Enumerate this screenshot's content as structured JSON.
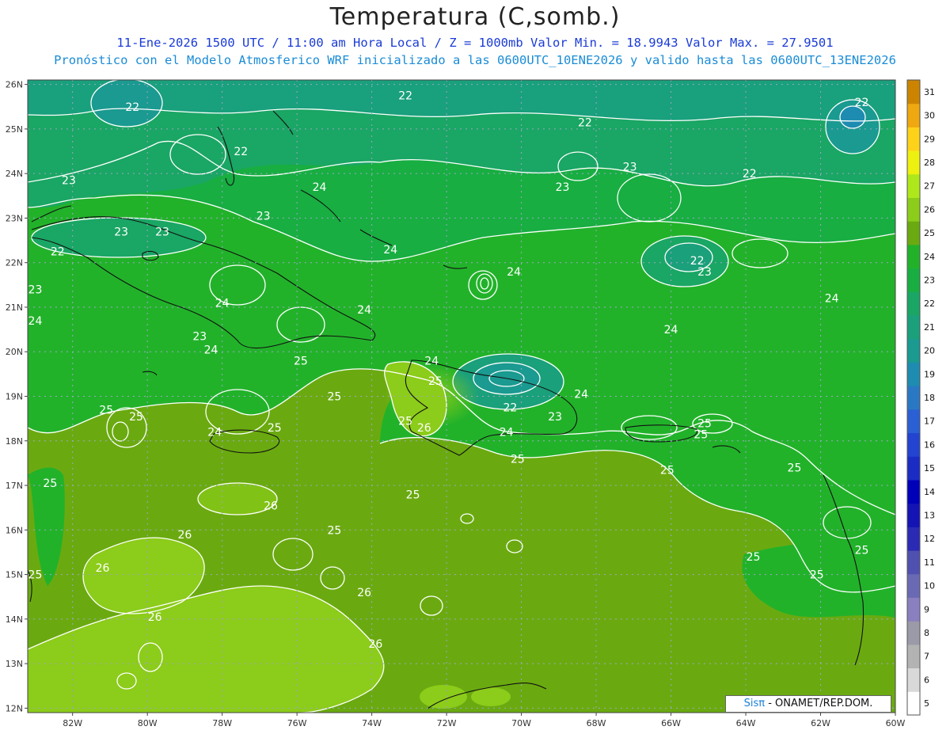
{
  "header": {
    "title": "Temperatura (C,somb.)",
    "line1": "11-Ene-2026 1500 UTC / 11:00 am Hora Local / Z = 1000mb  Valor Min. = 18.9943  Valor Max. = 27.9501",
    "line2": "Pronóstico con el Modelo Atmosferico WRF inicializado a las 0600UTC_10ENE2026 y valido hasta las  0600UTC_13ENE2026"
  },
  "map": {
    "lat_ticks": [
      "26N",
      "25N",
      "24N",
      "23N",
      "22N",
      "21N",
      "20N",
      "19N",
      "18N",
      "17N",
      "16N",
      "15N",
      "14N",
      "13N",
      "12N"
    ],
    "lon_ticks": [
      "82W",
      "80W",
      "78W",
      "76W",
      "74W",
      "72W",
      "70W",
      "68W",
      "66W",
      "64W",
      "62W",
      "60W"
    ],
    "grid": true
  },
  "colorbar": {
    "levels": [
      "5",
      "6",
      "7",
      "8",
      "9",
      "10",
      "11",
      "12",
      "13",
      "14",
      "15",
      "16",
      "17",
      "18",
      "19",
      "20",
      "21",
      "22",
      "23",
      "24",
      "25",
      "26",
      "27",
      "28",
      "29",
      "30",
      "31"
    ],
    "colors": [
      "#ffffff",
      "#d9d9d9",
      "#b3b3b3",
      "#9a9aa8",
      "#8a7fbf",
      "#6a6ab4",
      "#5050b0",
      "#2a2ab4",
      "#1414b4",
      "#0000b8",
      "#1a2cc4",
      "#2244d0",
      "#2a60d4",
      "#2a78c4",
      "#1e8cb0",
      "#1a9a90",
      "#1aa07a",
      "#1aa664",
      "#18ae42",
      "#22b22a",
      "#6aaa10",
      "#8ccc1a",
      "#aee81a",
      "#eef010",
      "#ffd21a",
      "#f0a810",
      "#cc8400"
    ]
  },
  "contour_labels": [
    {
      "text": "22",
      "lon": -73.1,
      "lat": 25.75
    },
    {
      "text": "22",
      "lon": -80.4,
      "lat": 25.5
    },
    {
      "text": "22",
      "lon": -68.3,
      "lat": 25.15
    },
    {
      "text": "22",
      "lon": -60.9,
      "lat": 25.6
    },
    {
      "text": "22",
      "lon": -77.5,
      "lat": 24.5
    },
    {
      "text": "22",
      "lon": -63.9,
      "lat": 24.0
    },
    {
      "text": "23",
      "lon": -82.1,
      "lat": 23.85
    },
    {
      "text": "23",
      "lon": -67.1,
      "lat": 24.15
    },
    {
      "text": "23",
      "lon": -68.9,
      "lat": 23.7
    },
    {
      "text": "24",
      "lon": -75.4,
      "lat": 23.7
    },
    {
      "text": "23",
      "lon": -76.9,
      "lat": 23.05
    },
    {
      "text": "23",
      "lon": -80.7,
      "lat": 22.7
    },
    {
      "text": "23",
      "lon": -79.6,
      "lat": 22.7
    },
    {
      "text": "24",
      "lon": -73.5,
      "lat": 22.3
    },
    {
      "text": "22",
      "lon": -82.4,
      "lat": 22.25
    },
    {
      "text": "22",
      "lon": -65.3,
      "lat": 22.05
    },
    {
      "text": "23",
      "lon": -65.1,
      "lat": 21.8
    },
    {
      "text": "24",
      "lon": -70.2,
      "lat": 21.8
    },
    {
      "text": "23",
      "lon": -83.0,
      "lat": 21.4
    },
    {
      "text": "24",
      "lon": -78.0,
      "lat": 21.1
    },
    {
      "text": "24",
      "lon": -61.7,
      "lat": 21.2
    },
    {
      "text": "24",
      "lon": -74.2,
      "lat": 20.95
    },
    {
      "text": "24",
      "lon": -83.0,
      "lat": 20.7
    },
    {
      "text": "24",
      "lon": -66.0,
      "lat": 20.5
    },
    {
      "text": "23",
      "lon": -78.6,
      "lat": 20.35
    },
    {
      "text": "24",
      "lon": -78.3,
      "lat": 20.05
    },
    {
      "text": "24",
      "lon": -72.4,
      "lat": 19.8
    },
    {
      "text": "25",
      "lon": -75.9,
      "lat": 19.8
    },
    {
      "text": "25",
      "lon": -72.3,
      "lat": 19.35
    },
    {
      "text": "24",
      "lon": -68.4,
      "lat": 19.05
    },
    {
      "text": "25",
      "lon": -75.0,
      "lat": 19.0
    },
    {
      "text": "22",
      "lon": -70.3,
      "lat": 18.75
    },
    {
      "text": "25",
      "lon": -81.1,
      "lat": 18.7
    },
    {
      "text": "25",
      "lon": -80.3,
      "lat": 18.55
    },
    {
      "text": "23",
      "lon": -69.1,
      "lat": 18.55
    },
    {
      "text": "25",
      "lon": -73.1,
      "lat": 18.45
    },
    {
      "text": "26",
      "lon": -72.6,
      "lat": 18.3
    },
    {
      "text": "25",
      "lon": -65.1,
      "lat": 18.4
    },
    {
      "text": "25",
      "lon": -65.2,
      "lat": 18.15
    },
    {
      "text": "24",
      "lon": -78.2,
      "lat": 18.2
    },
    {
      "text": "25",
      "lon": -76.6,
      "lat": 18.3
    },
    {
      "text": "24",
      "lon": -70.4,
      "lat": 18.2
    },
    {
      "text": "25",
      "lon": -70.1,
      "lat": 17.6
    },
    {
      "text": "25",
      "lon": -62.7,
      "lat": 17.4
    },
    {
      "text": "25",
      "lon": -66.1,
      "lat": 17.35
    },
    {
      "text": "25",
      "lon": -82.6,
      "lat": 17.05
    },
    {
      "text": "25",
      "lon": -72.9,
      "lat": 16.8
    },
    {
      "text": "26",
      "lon": -76.7,
      "lat": 16.55
    },
    {
      "text": "26",
      "lon": -79.0,
      "lat": 15.9
    },
    {
      "text": "25",
      "lon": -75.0,
      "lat": 16.0
    },
    {
      "text": "25",
      "lon": -63.8,
      "lat": 15.4
    },
    {
      "text": "25",
      "lon": -60.9,
      "lat": 15.55
    },
    {
      "text": "26",
      "lon": -81.2,
      "lat": 15.15
    },
    {
      "text": "25",
      "lon": -83.0,
      "lat": 15.0
    },
    {
      "text": "25",
      "lon": -62.1,
      "lat": 15.0
    },
    {
      "text": "26",
      "lon": -74.2,
      "lat": 14.6
    },
    {
      "text": "26",
      "lon": -79.8,
      "lat": 14.05
    },
    {
      "text": "26",
      "lon": -73.9,
      "lat": 13.45
    }
  ],
  "credit": {
    "brand": "Sisπ",
    "text": " - ONAMET/REP.DOM."
  }
}
